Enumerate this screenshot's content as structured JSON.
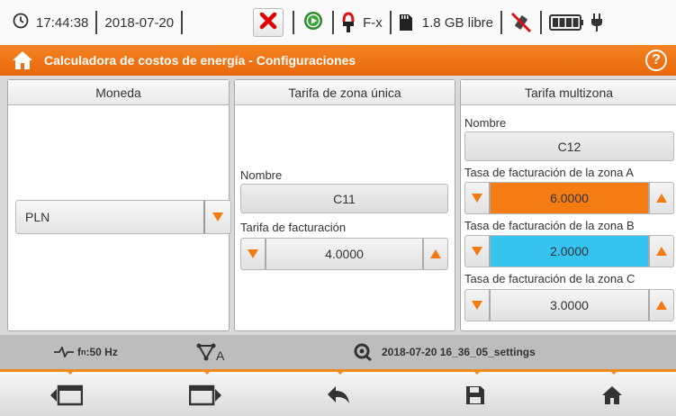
{
  "status": {
    "time": "17:44:38",
    "date": "2018-07-20",
    "mode": "F-x",
    "storage": "1.8 GB libre"
  },
  "title": "Calculadora de costos de energía - Configuraciones",
  "help": "?",
  "currency": {
    "header": "Moneda",
    "selected": "PLN"
  },
  "single": {
    "header": "Tarifa de zona única",
    "name_label": "Nombre",
    "name_value": "C11",
    "rate_label": "Tarifa de facturación",
    "rate_value": "4.0000"
  },
  "multi": {
    "header": "Tarifa multizona",
    "name_label": "Nombre",
    "name_value": "C12",
    "zone_a_label": "Tasa de facturación de la zona A",
    "zone_a_value": "6.0000",
    "zone_b_label": "Tasa de facturación de la zona B",
    "zone_b_value": "2.0000",
    "zone_c_label": "Tasa de facturación de la zona C",
    "zone_c_value": "3.0000",
    "zone_a_color": "#f47c12",
    "zone_b_color": "#35c3ef"
  },
  "info": {
    "frequency": "50 Hz",
    "frequency_prefix": "f",
    "frequency_sub": "n",
    "phase_label": "A",
    "settings_file": "2018-07-20 16_36_05_settings"
  },
  "colors": {
    "accent": "#f08a1c",
    "title_bar": "#e8680c"
  },
  "icons": [
    "clock-icon",
    "close-icon",
    "play-icon",
    "probe-icon",
    "sd-card-icon",
    "no-gps-icon",
    "battery-icon",
    "plug-icon",
    "home-icon",
    "help-icon",
    "waveform-icon",
    "phasor-icon",
    "settings-file-icon",
    "prev-screen-icon",
    "next-screen-icon",
    "back-icon",
    "save-icon",
    "home-icon"
  ]
}
